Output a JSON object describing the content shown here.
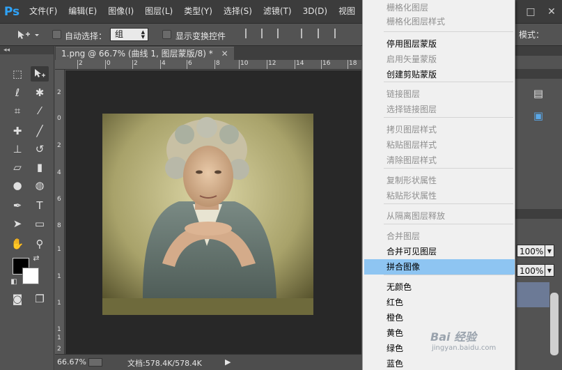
{
  "app": {
    "logo": "Ps"
  },
  "menubar": {
    "items": [
      "文件(F)",
      "编辑(E)",
      "图像(I)",
      "图层(L)",
      "类型(Y)",
      "选择(S)",
      "滤镜(T)",
      "3D(D)",
      "视图"
    ],
    "window_buttons": {
      "minimize": "─",
      "maximize": "□",
      "close": "✕"
    }
  },
  "optionsbar": {
    "auto_select_label": "自动选择：",
    "auto_select_value": "组",
    "show_transform_label": "显示变换控件",
    "mode_label": "模式："
  },
  "document": {
    "tab_title": "1.png @ 66.7% (曲线 1, 图层蒙版/8) *",
    "close": "✕"
  },
  "ruler": {
    "top_labels": [
      "2",
      "0",
      "2",
      "4",
      "6",
      "8",
      "10",
      "12",
      "14",
      "16",
      "18"
    ],
    "left_labels": [
      "2",
      "0",
      "2",
      "4",
      "6",
      "8",
      "1",
      "1",
      "1",
      "1",
      "1",
      "2"
    ]
  },
  "statusbar": {
    "zoom": "66.67%",
    "doc_info": "文档:578.4K/578.4K"
  },
  "panels": {
    "opacity": "100%",
    "fill": "100%"
  },
  "context_menu": {
    "items": [
      {
        "label": "栅格化图层",
        "enabled": false
      },
      {
        "label": "栅格化图层样式",
        "enabled": false
      },
      {
        "label": "停用图层蒙版",
        "enabled": true
      },
      {
        "label": "启用矢量蒙版",
        "enabled": false
      },
      {
        "label": "创建剪贴蒙版",
        "enabled": true
      },
      {
        "label": "链接图层",
        "enabled": false
      },
      {
        "label": "选择链接图层",
        "enabled": false
      },
      {
        "label": "拷贝图层样式",
        "enabled": false
      },
      {
        "label": "粘贴图层样式",
        "enabled": false
      },
      {
        "label": "清除图层样式",
        "enabled": false
      },
      {
        "label": "复制形状属性",
        "enabled": false
      },
      {
        "label": "粘贴形状属性",
        "enabled": false
      },
      {
        "label": "从隔离图层释放",
        "enabled": false
      },
      {
        "label": "合并图层",
        "enabled": false
      },
      {
        "label": "合并可见图层",
        "enabled": true
      },
      {
        "label": "拼合图像",
        "enabled": true,
        "highlighted": true
      },
      {
        "label": "无颜色",
        "enabled": true
      },
      {
        "label": "红色",
        "enabled": true
      },
      {
        "label": "橙色",
        "enabled": true
      },
      {
        "label": "黄色",
        "enabled": true
      },
      {
        "label": "绿色",
        "enabled": true
      },
      {
        "label": "蓝色",
        "enabled": true
      }
    ]
  },
  "watermark": {
    "brand": "Bai 经验",
    "url": "jingyan.baidu.com"
  },
  "colors": {
    "foreground": "#000000",
    "background": "#ffffff",
    "highlight": "#8ec5f2",
    "ps_blue": "#2fa3f7"
  }
}
